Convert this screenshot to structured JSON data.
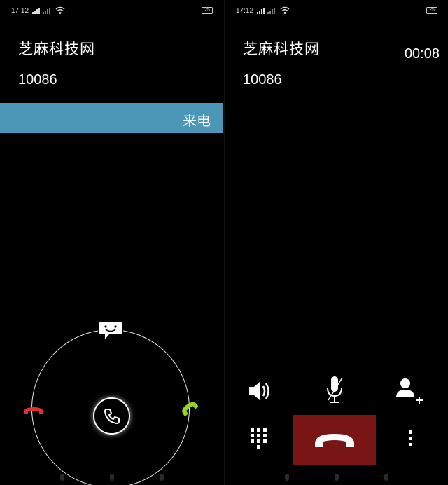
{
  "incoming_screen": {
    "status": {
      "time": "17:12",
      "battery": "25"
    },
    "caller_name": "芝麻科技网",
    "caller_number": "10086",
    "incoming_label": "来电"
  },
  "active_screen": {
    "status": {
      "time": "17:12",
      "battery": "25"
    },
    "caller_name": "芝麻科技网",
    "caller_number": "10086",
    "call_timer": "00:08"
  },
  "colors": {
    "incoming_bar": "#4a97b8",
    "decline": "#e0312c",
    "accept": "#9bd21a",
    "end_call_bg": "#7a1515"
  },
  "icons": [
    "message-icon",
    "phone-answer-icon",
    "phone-decline-icon",
    "phone-accept-icon",
    "speaker-icon",
    "mute-mic-icon",
    "add-contact-icon",
    "dialpad-icon",
    "end-call-icon",
    "more-icon",
    "wifi-icon",
    "signal-icon",
    "battery-icon"
  ]
}
